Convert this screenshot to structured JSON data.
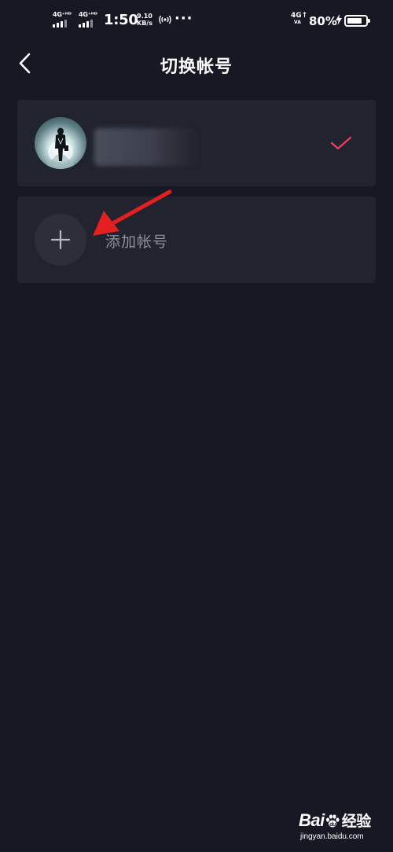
{
  "status_bar": {
    "net1_label": "4G⁺ᴴᴰ",
    "net2_label": "4G⁺ᴴᴰ",
    "time": "1:50",
    "speed_value": "9.10",
    "speed_unit": "KB/s",
    "dots": "···",
    "right_net": "4G↑",
    "right_net_sub": "VA",
    "battery_percent": "80%",
    "battery_level": 0.8
  },
  "header": {
    "title": "切换帐号",
    "back_icon": "chevron-left-icon"
  },
  "accounts": [
    {
      "name": "",
      "selected": true,
      "check_icon": "check-icon"
    }
  ],
  "add_account": {
    "label": "添加帐号",
    "icon": "plus-icon"
  },
  "colors": {
    "background": "#171824",
    "card": "#21232f",
    "accent": "#ee3a5d",
    "annotation": "#e41f1f",
    "muted_text": "#8d8f99"
  },
  "watermark": {
    "brand": "Bai",
    "brand_tail": "du",
    "brand_cn": "经验",
    "url": "jingyan.baidu.com"
  }
}
